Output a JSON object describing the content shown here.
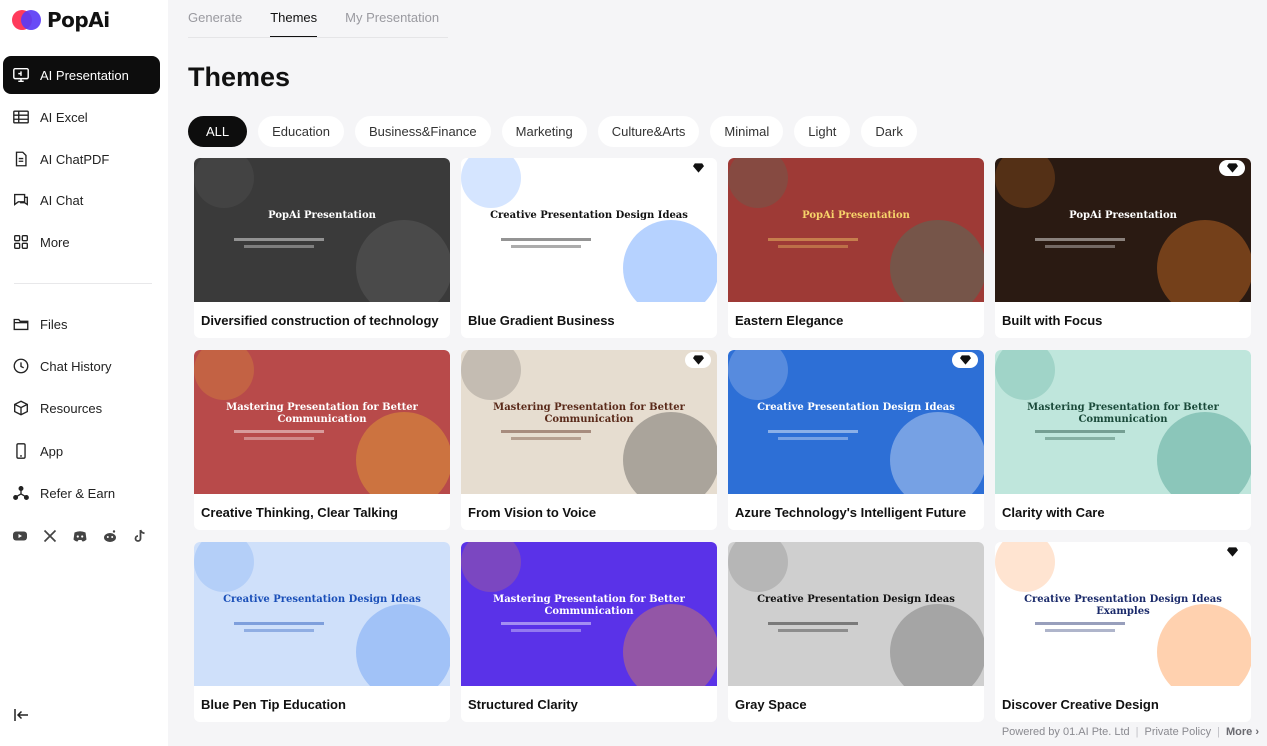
{
  "brand": {
    "name": "PopAi"
  },
  "sidebar": {
    "items": [
      {
        "label": "AI Presentation",
        "icon": "presentation-icon",
        "active": true
      },
      {
        "label": "AI Excel",
        "icon": "table-icon"
      },
      {
        "label": "AI ChatPDF",
        "icon": "document-icon"
      },
      {
        "label": "AI Chat",
        "icon": "chat-icon"
      },
      {
        "label": "More",
        "icon": "grid-icon"
      }
    ],
    "items2": [
      {
        "label": "Files",
        "icon": "folder-icon"
      },
      {
        "label": "Chat History",
        "icon": "clock-icon"
      },
      {
        "label": "Resources",
        "icon": "cube-icon"
      },
      {
        "label": "App",
        "icon": "phone-icon"
      },
      {
        "label": "Refer & Earn",
        "icon": "share-icon"
      }
    ],
    "socials": [
      "youtube-icon",
      "x-icon",
      "discord-icon",
      "reddit-icon",
      "tiktok-icon"
    ]
  },
  "tabs": [
    "Generate",
    "Themes",
    "My Presentation"
  ],
  "active_tab": "Themes",
  "page_title": "Themes",
  "filters": [
    "ALL",
    "Education",
    "Business&Finance",
    "Marketing",
    "Culture&Arts",
    "Minimal",
    "Light",
    "Dark"
  ],
  "active_filter": "ALL",
  "cards": [
    {
      "title": "Diversified construction of technology",
      "pro": false,
      "heading": "PopAi Presentation",
      "bg": "#3a3a3a",
      "fg": "#ffffff"
    },
    {
      "title": "Blue Gradient Business",
      "pro": true,
      "heading": "Creative Presentation Design Ideas",
      "bg": "#ffffff",
      "fg": "#111111"
    },
    {
      "title": "Eastern Elegance",
      "pro": false,
      "heading": "PopAi Presentation",
      "bg": "#9e3a36",
      "fg": "#f7d36a"
    },
    {
      "title": "Built with Focus",
      "pro": true,
      "heading": "PopAi Presentation",
      "bg": "#2a1a12",
      "fg": "#ffffff"
    },
    {
      "title": "Creative Thinking, Clear Talking",
      "pro": false,
      "heading": "Mastering Presentation for Better Communication",
      "bg": "#b84a4a",
      "fg": "#ffffff"
    },
    {
      "title": "From Vision to Voice",
      "pro": true,
      "heading": "Mastering Presentation for Better Communication",
      "bg": "#e6ddd0",
      "fg": "#5a2a1a"
    },
    {
      "title": "Azure Technology's Intelligent Future",
      "pro": true,
      "heading": "Creative Presentation Design Ideas",
      "bg": "#2d6fd6",
      "fg": "#ffffff"
    },
    {
      "title": "Clarity with Care",
      "pro": false,
      "heading": "Mastering Presentation for Better Communication",
      "bg": "#bfe6dc",
      "fg": "#1a4a3a"
    },
    {
      "title": "Blue Pen Tip Education",
      "pro": false,
      "heading": "Creative Presentation Design Ideas",
      "bg": "#cfe0fa",
      "fg": "#1a4fb8"
    },
    {
      "title": "Structured Clarity",
      "pro": false,
      "heading": "Mastering Presentation for Better Communication",
      "bg": "#5a32e8",
      "fg": "#ffffff"
    },
    {
      "title": "Gray Space",
      "pro": false,
      "heading": "Creative Presentation Design Ideas",
      "bg": "#cfcfcf",
      "fg": "#111111"
    },
    {
      "title": "Discover Creative Design",
      "pro": true,
      "heading": "Creative Presentation Design Ideas Examples",
      "bg": "#ffffff",
      "fg": "#1a2a6a"
    }
  ],
  "footer": {
    "powered": "Powered by 01.AI Pte. Ltd",
    "policy": "Private Policy",
    "more": "More"
  }
}
